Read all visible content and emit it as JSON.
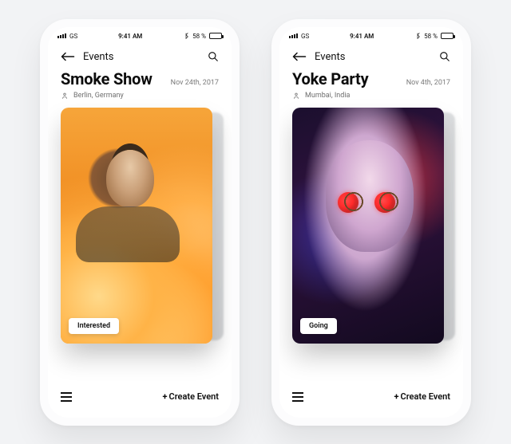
{
  "phones": [
    {
      "status": {
        "carrier": "GS",
        "time": "9:41 AM",
        "battery_pct": "58 %"
      },
      "nav": {
        "title": "Events"
      },
      "event": {
        "title": "Smoke Show",
        "date": "Nov 24th, 2017",
        "location": "Berlin, Germany",
        "rsvp_label": "Interested"
      },
      "bottom": {
        "create_label": "Create Event"
      }
    },
    {
      "status": {
        "carrier": "GS",
        "time": "9:41 AM",
        "battery_pct": "58 %"
      },
      "nav": {
        "title": "Events"
      },
      "event": {
        "title": "Yoke Party",
        "date": "Nov 4th, 2017",
        "location": "Mumbai, India",
        "rsvp_label": "Going"
      },
      "bottom": {
        "create_label": "Create Event"
      }
    }
  ]
}
